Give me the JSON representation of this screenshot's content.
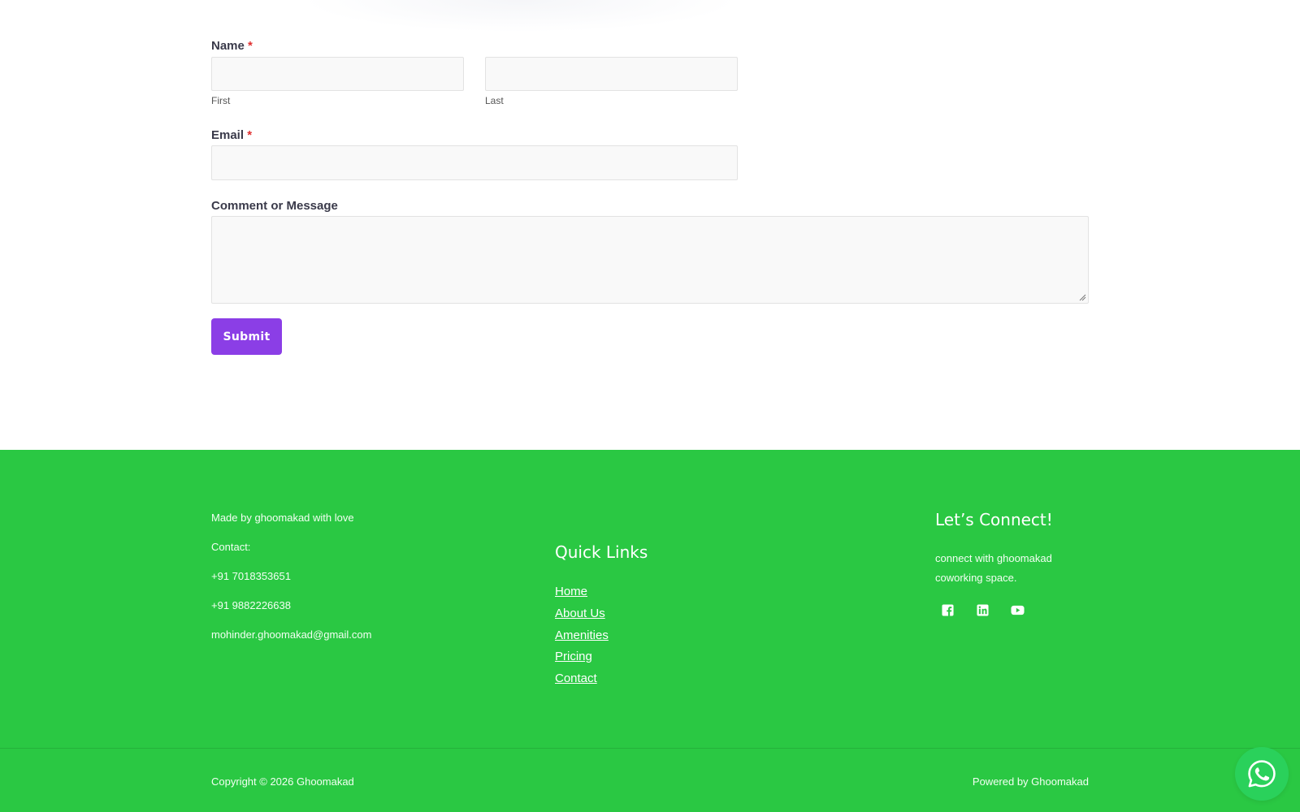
{
  "form": {
    "name_label": "Name",
    "required_mark": "*",
    "first_sublabel": "First",
    "last_sublabel": "Last",
    "first_value": "",
    "last_value": "",
    "email_label": "Email",
    "email_value": "",
    "message_label": "Comment or Message",
    "message_value": "",
    "submit_label": "Submit"
  },
  "footer": {
    "about": {
      "made_by": "Made by ghoomakad with love",
      "contact_label": "Contact:",
      "phone_1": "+91 7018353651",
      "phone_2": "+91 9882226638",
      "email": "mohinder.ghoomakad@gmail.com"
    },
    "quick_links": {
      "title": "Quick Links",
      "items": [
        {
          "label": "Home"
        },
        {
          "label": "About Us"
        },
        {
          "label": "Amenities"
        },
        {
          "label": "Pricing"
        },
        {
          "label": "Contact"
        }
      ]
    },
    "connect": {
      "title": "Let’s Connect!",
      "line_1": "connect with ghoomakad",
      "line_2": "coworking space.",
      "socials": [
        {
          "icon": "facebook-icon"
        },
        {
          "icon": "linkedin-icon"
        },
        {
          "icon": "youtube-icon"
        }
      ]
    },
    "copyright": "Copyright © 2026 Ghoomakad",
    "powered_by": "Powered by Ghoomakad"
  },
  "colors": {
    "accent": "#8b3ee6",
    "footer_bg": "#2ac843",
    "whatsapp": "#2ad15b",
    "required": "#e03030"
  },
  "widgets": {
    "whatsapp_icon": "whatsapp-icon"
  }
}
